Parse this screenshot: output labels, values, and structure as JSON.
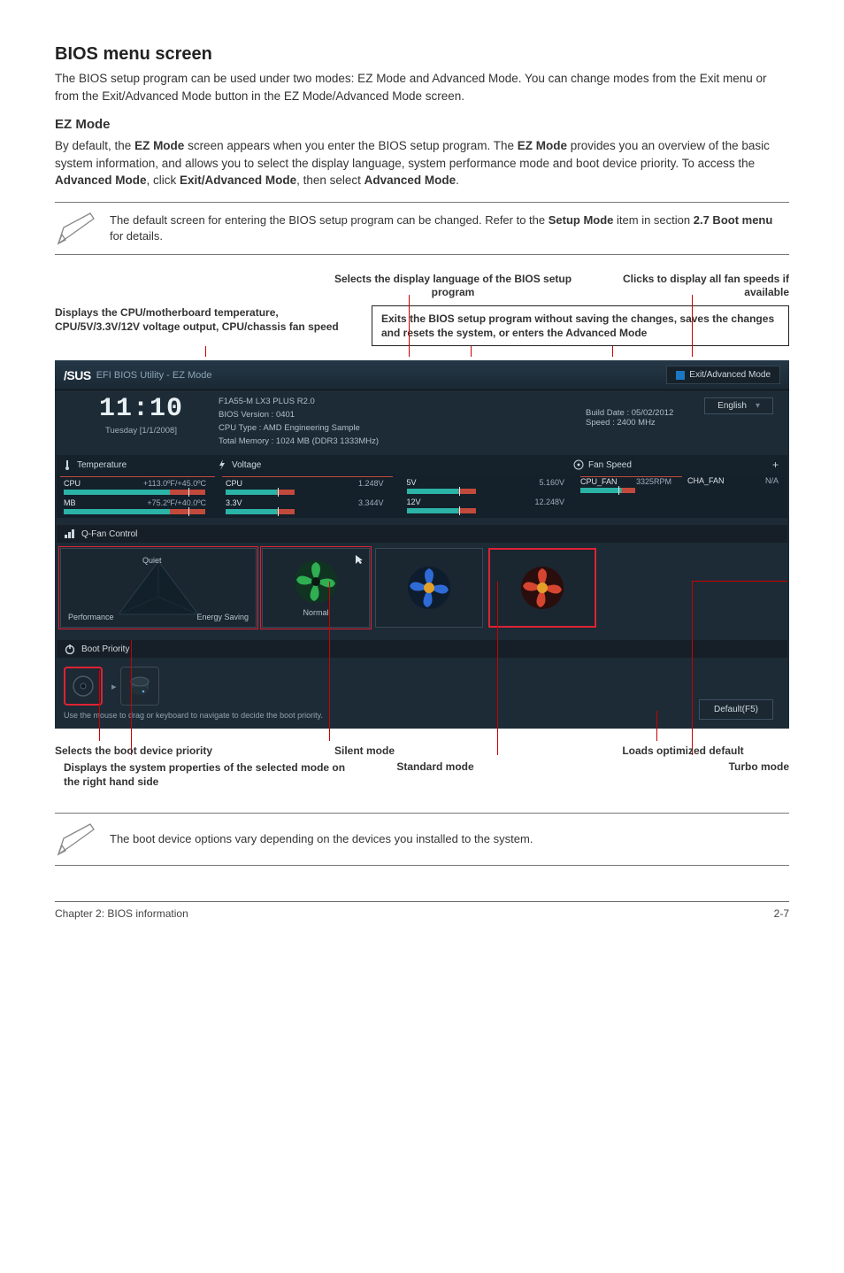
{
  "heading_main": "BIOS menu screen",
  "intro_para": "The BIOS setup program can be used under two modes: EZ Mode and Advanced Mode. You can change modes from the Exit menu or from the Exit/Advanced Mode button in the EZ Mode/Advanced Mode screen.",
  "heading_ez": "EZ Mode",
  "ez_para_prefix": "By default, the ",
  "ez_bold1": "EZ Mode",
  "ez_para_mid1": " screen appears when you enter the BIOS setup program. The ",
  "ez_bold2": "EZ Mode",
  "ez_para_mid2": " provides you an overview of the basic system information, and allows you to select the display language, system performance mode and boot device priority. To access the ",
  "ez_bold3": "Advanced Mode",
  "ez_para_mid3": ", click ",
  "ez_bold4": "Exit/Advanced Mode",
  "ez_para_mid4": ", then select ",
  "ez_bold5": "Advanced Mode",
  "ez_para_end": ".",
  "note1_pre": "The default screen for entering the BIOS setup program can be changed. Refer to the ",
  "note1_bold1": "Setup Mode",
  "note1_mid": " item in section ",
  "note1_bold2": "2.7 Boot menu",
  "note1_end": " for details.",
  "annot_top_mid": "Selects the display language of the BIOS setup program",
  "annot_top_right": "Clicks to display all fan speeds if available",
  "annot_top_left": "Displays the CPU/motherboard temperature, CPU/5V/3.3V/12V voltage output, CPU/chassis fan speed",
  "annot_right_box": "Exits the BIOS setup program without saving the changes, saves the changes and resets the system, or enters the Advanced Mode",
  "bios": {
    "logo_text": "/SUS",
    "header_title": "EFI BIOS Utility - EZ Mode",
    "exit_btn": "Exit/Advanced Mode",
    "english_btn": "English",
    "clock_time": "11:10",
    "clock_date": "Tuesday [1/1/2008]",
    "board": "F1A55-M LX3 PLUS R2.0",
    "bios_ver": "BIOS Version : 0401",
    "cpu_type": "CPU Type : AMD Engineering Sample",
    "total_mem": "Total Memory : 1024 MB (DDR3 1333MHz)",
    "build_date": "Build Date : 05/02/2012",
    "speed": "Speed : 2400 MHz",
    "hdr_temp": "Temperature",
    "hdr_volt": "Voltage",
    "hdr_fan": "Fan Speed",
    "temp_cpu_lbl": "CPU",
    "temp_cpu_val": "+113.0ºF/+45.0ºC",
    "temp_mb_lbl": "MB",
    "temp_mb_val": "+75.2ºF/+40.0ºC",
    "v_cpu_lbl": "CPU",
    "v_cpu_val": "1.248V",
    "v_5_lbl": "5V",
    "v_5_val": "5.160V",
    "v_33_lbl": "3.3V",
    "v_33_val": "3.344V",
    "v_12_lbl": "12V",
    "v_12_val": "12.248V",
    "fan_cpu_lbl": "CPU_FAN",
    "fan_cpu_val": "3325RPM",
    "fan_cha_lbl": "CHA_FAN",
    "fan_cha_val": "N/A",
    "qfan_title": "Q-Fan Control",
    "pyr_quiet": "Quiet",
    "pyr_perf": "Performance",
    "pyr_energy": "Energy Saving",
    "swatch_normal": "Normal",
    "boot_title": "Boot Priority",
    "boot_hint": "Use the mouse to drag or keyboard to navigate to decide the boot priority.",
    "default_btn": "Default(F5)"
  },
  "annot_b1": "Selects the boot device priority",
  "annot_b2": "Silent mode",
  "annot_b3": "Loads optimized default",
  "annot_b4": "Displays the system properties of the selected mode on the right hand side",
  "annot_b5": "Standard mode",
  "annot_b6": "Turbo mode",
  "note2": "The boot device options vary depending on the devices you installed to the system.",
  "footer_left": "Chapter 2: BIOS information",
  "footer_right": "2-7"
}
